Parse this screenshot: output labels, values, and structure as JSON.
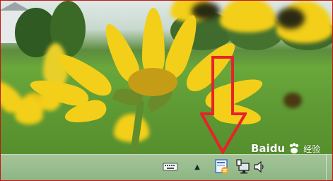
{
  "taskbar": {
    "tray_icons": [
      {
        "name": "keyboard-icon",
        "label": ""
      },
      {
        "name": "show-hidden-icons-chevron",
        "glyph": "▲"
      },
      {
        "name": "app-tray-icon",
        "label": ""
      },
      {
        "name": "network-icon",
        "label": ""
      },
      {
        "name": "volume-icon",
        "label": ""
      }
    ]
  },
  "watermark": {
    "latin": "Baidu",
    "cjk": "经验"
  },
  "annotation": {
    "arrow_color": "#e8222a"
  },
  "colors": {
    "frame_border": "#c41616",
    "flower": "#f3cf19",
    "grass": "#5f9a34"
  }
}
